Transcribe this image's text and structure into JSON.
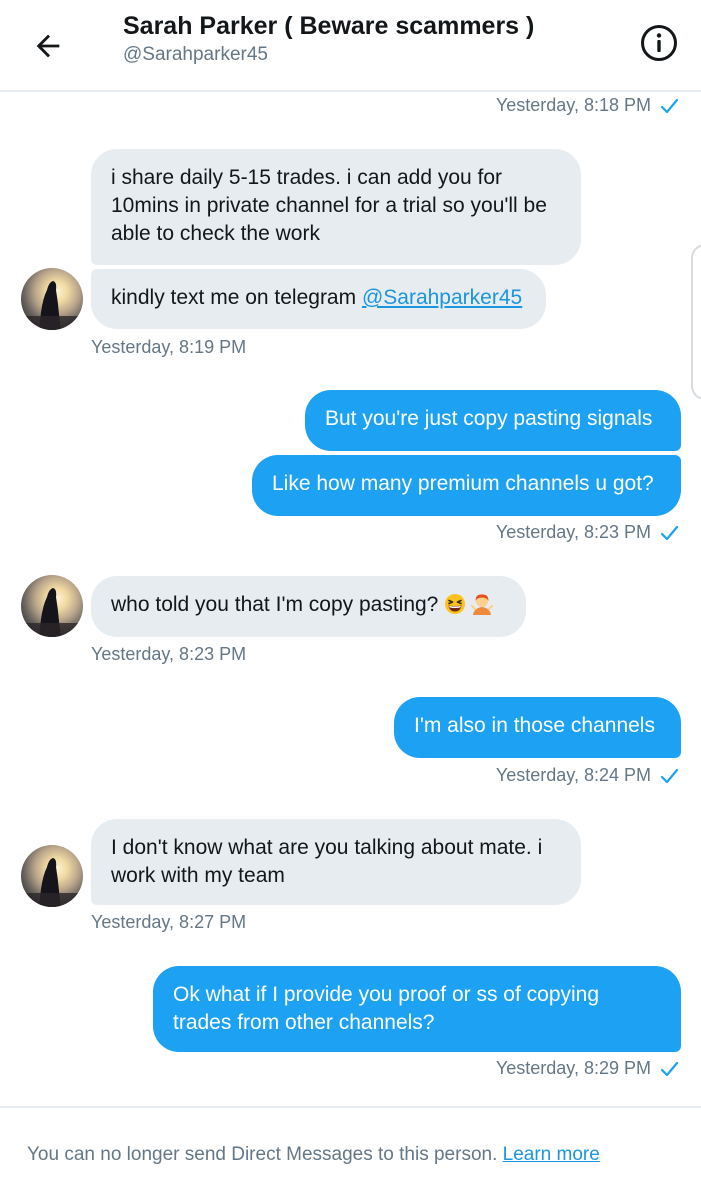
{
  "header": {
    "title": "Sarah Parker ( Beware scammers )",
    "handle": "@Sarahparker45",
    "back_icon": "arrow-left-icon",
    "info_icon": "info-circle-icon"
  },
  "colors": {
    "accent": "#1da1f2",
    "received_bubble": "#e6ecf0",
    "secondary_text": "#657786",
    "link": "#1b95e0"
  },
  "messages": [
    {
      "id": "ts1",
      "time": "Yesterday, 8:18 PM"
    },
    {
      "id": "m1",
      "direction": "received",
      "text": "i share daily 5-15 trades. i can add you for 10mins in private channel for a trial so you'll be able to check the work"
    },
    {
      "id": "m2",
      "direction": "received",
      "text": "kindly text me on telegram ",
      "link": "@Sarahparker45"
    },
    {
      "id": "ts2",
      "time": "Yesterday, 8:19 PM"
    },
    {
      "id": "m3",
      "direction": "sent",
      "text": "But you're just copy pasting signals"
    },
    {
      "id": "m4",
      "direction": "sent",
      "text": "Like how many premium channels u got?"
    },
    {
      "id": "ts3",
      "time": "Yesterday, 8:23 PM"
    },
    {
      "id": "m5",
      "direction": "received",
      "text": "who told you that I'm copy pasting? ",
      "emojis": [
        "grinning-squinting-face-emoji",
        "person-shrugging-emoji"
      ]
    },
    {
      "id": "ts4",
      "time": "Yesterday, 8:23 PM"
    },
    {
      "id": "m6",
      "direction": "sent",
      "text": "I'm also in those channels"
    },
    {
      "id": "ts5",
      "time": "Yesterday, 8:24 PM"
    },
    {
      "id": "m7",
      "direction": "received",
      "text": "I don't know what are you talking about mate. i work with my team"
    },
    {
      "id": "ts6",
      "time": "Yesterday, 8:27 PM"
    },
    {
      "id": "m8",
      "direction": "sent",
      "text": "Ok what if I provide you proof or ss of copying trades from other channels?"
    },
    {
      "id": "ts7",
      "time": "Yesterday, 8:29 PM"
    }
  ],
  "footer": {
    "notice": "You can no longer send Direct Messages to this person.",
    "link_label": "Learn more"
  }
}
